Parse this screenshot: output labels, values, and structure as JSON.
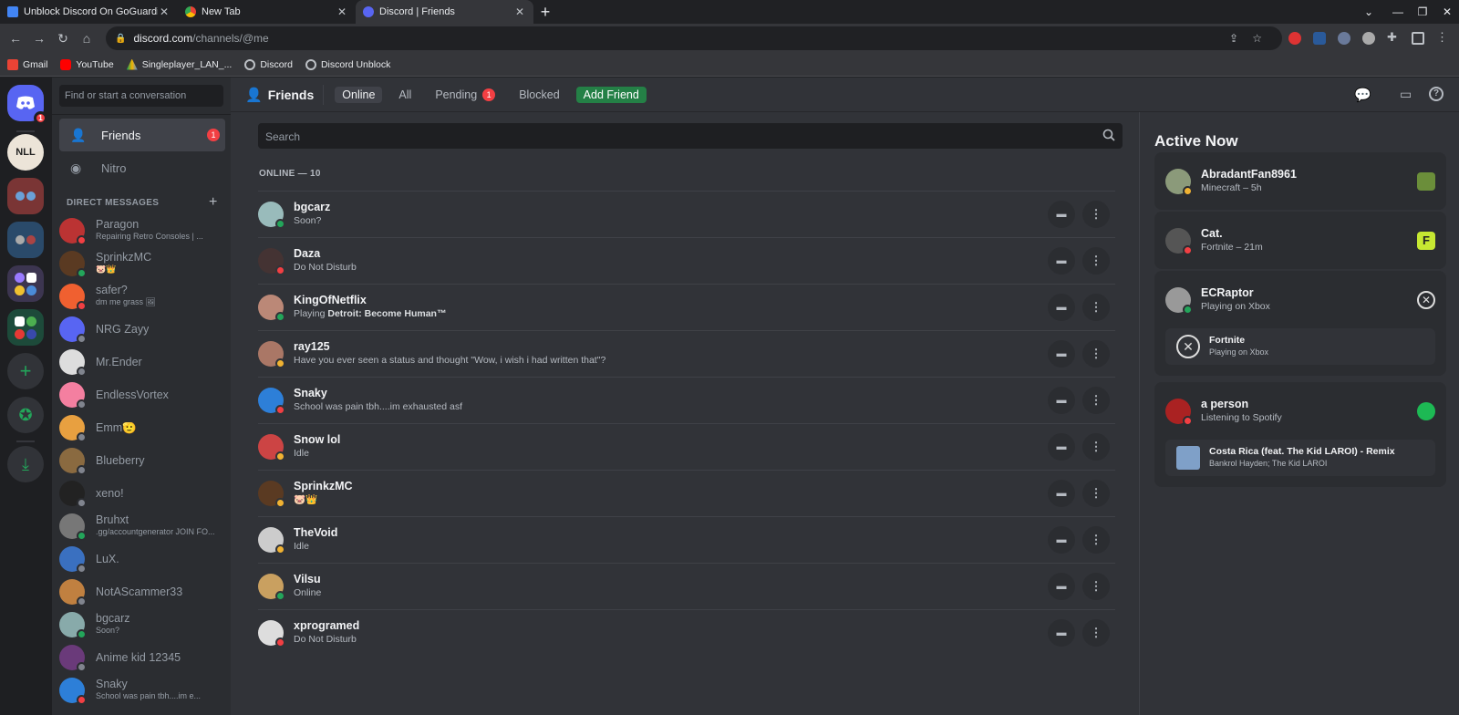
{
  "browser": {
    "tabs": [
      {
        "label": "Unblock Discord On GoGuardian",
        "icon": "google-docs-icon",
        "color": "#4285f4"
      },
      {
        "label": "New Tab",
        "icon": "chrome-icon",
        "color": "#e8eaed"
      },
      {
        "label": "Discord | Friends",
        "icon": "discord-icon",
        "color": "#5865f2"
      }
    ],
    "url_host": "discord.com",
    "url_path": "/channels/@me",
    "bookmarks": [
      "Gmail",
      "YouTube",
      "Singleplayer_LAN_...",
      "Discord",
      "Discord Unblock"
    ]
  },
  "servers": {
    "home_badge": "1",
    "nll_label": "NLL"
  },
  "dm_sidebar": {
    "search_placeholder": "Find or start a conversation",
    "nav": [
      {
        "label": "Friends",
        "badge": "1"
      },
      {
        "label": "Nitro"
      }
    ],
    "header": "DIRECT MESSAGES",
    "dms": [
      {
        "name": "Paragon",
        "sub": "Repairing Retro Consoles | ...",
        "status": "dnd",
        "color": "#b33"
      },
      {
        "name": "SprinkzMC",
        "sub": "🐷👑",
        "status": "online",
        "color": "#5a3a22"
      },
      {
        "name": "safer?",
        "sub": "dm me grass 🖼",
        "status": "dnd",
        "color": "#f06030"
      },
      {
        "name": "NRG Zayy",
        "sub": "",
        "status": "off",
        "color": "#5865f2"
      },
      {
        "name": "Mr.Ender",
        "sub": "",
        "status": "off",
        "color": "#ddd"
      },
      {
        "name": "EndlessVortex",
        "sub": "",
        "status": "off",
        "color": "#f47fa0"
      },
      {
        "name": "Emm🫡",
        "sub": "",
        "status": "off",
        "color": "#e8a040"
      },
      {
        "name": "Blueberry",
        "sub": "",
        "status": "off",
        "color": "#8a6a40"
      },
      {
        "name": "xeno!",
        "sub": "",
        "status": "off",
        "color": "#222"
      },
      {
        "name": "Bruhxt",
        "sub": ".gg/accountgenerator JOIN FO...",
        "status": "online",
        "color": "#777"
      },
      {
        "name": "LuX.",
        "sub": "",
        "status": "off",
        "color": "#3a70c0"
      },
      {
        "name": "NotAScammer33",
        "sub": "",
        "status": "off",
        "color": "#c08040"
      },
      {
        "name": "bgcarz",
        "sub": "Soon?",
        "status": "online",
        "color": "#8aa"
      },
      {
        "name": "Anime kid 12345",
        "sub": "",
        "status": "off",
        "color": "#6a3a7a"
      },
      {
        "name": "Snaky",
        "sub": "School was pain tbh....im e...",
        "status": "dnd",
        "color": "#2d7fd8"
      }
    ]
  },
  "header": {
    "title": "Friends",
    "tabs": [
      {
        "label": "Online",
        "selected": true
      },
      {
        "label": "All"
      },
      {
        "label": "Pending",
        "badge": "1"
      },
      {
        "label": "Blocked"
      }
    ],
    "add_friend": "Add Friend"
  },
  "friends": {
    "search_placeholder": "Search",
    "online_header": "ONLINE — 10",
    "list": [
      {
        "name": "bgcarz",
        "status_text": "Soon?",
        "status": "online",
        "color": "#9bb"
      },
      {
        "name": "Daza",
        "status_text": "Do Not Disturb",
        "status": "dnd",
        "color": "#433"
      },
      {
        "name": "KingOfNetflix",
        "status_prefix": "Playing ",
        "status_game": "Detroit: Become Human™",
        "status": "online",
        "color": "#b87"
      },
      {
        "name": "ray125",
        "status_text": "Have you ever seen a status and thought \"Wow, i wish i had written that\"?",
        "status": "idle",
        "color": "#a76"
      },
      {
        "name": "Snaky",
        "status_text": "School was pain tbh....im exhausted asf",
        "status": "dnd",
        "color": "#2d7fd8"
      },
      {
        "name": "Snow lol",
        "status_text": "Idle",
        "status": "idle",
        "color": "#c44"
      },
      {
        "name": "SprinkzMC",
        "status_text": "🐷👑",
        "status": "idle",
        "color": "#5a3a22"
      },
      {
        "name": "TheVoid",
        "status_text": "Idle",
        "status": "idle",
        "color": "#ccc"
      },
      {
        "name": "Vilsu",
        "status_text": "Online",
        "status": "online",
        "color": "#c9a060"
      },
      {
        "name": "xprogramed",
        "status_text": "Do Not Disturb",
        "status": "dnd",
        "color": "#ddd"
      }
    ]
  },
  "active_now": {
    "title": "Active Now",
    "cards": [
      {
        "name": "AbradantFan8961",
        "sub": "Minecraft – 5h",
        "icon": "minecraft-icon",
        "icon_color": "#6b8e3a",
        "color": "#8b9a7a",
        "status": "idle"
      },
      {
        "name": "Cat.",
        "sub": "Fortnite – 21m",
        "icon": "fortnite-icon",
        "icon_color": "#c6e832",
        "color": "#555",
        "status": "dnd"
      },
      {
        "name": "ECRaptor",
        "sub": "Playing on Xbox",
        "icon": "xbox-icon",
        "icon_color": "#ddd",
        "color": "#999",
        "status": "online",
        "sub_card": {
          "title": "Fortnite",
          "sub": "Playing on Xbox"
        }
      },
      {
        "name": "a person",
        "sub": "Listening to Spotify",
        "icon": "spotify-icon",
        "icon_color": "#1db954",
        "color": "#a22",
        "status": "dnd",
        "sub_card": {
          "title": "Costa Rica (feat. The Kid LAROI) - Remix",
          "sub": "Bankrol Hayden; The Kid LAROI"
        }
      }
    ]
  }
}
